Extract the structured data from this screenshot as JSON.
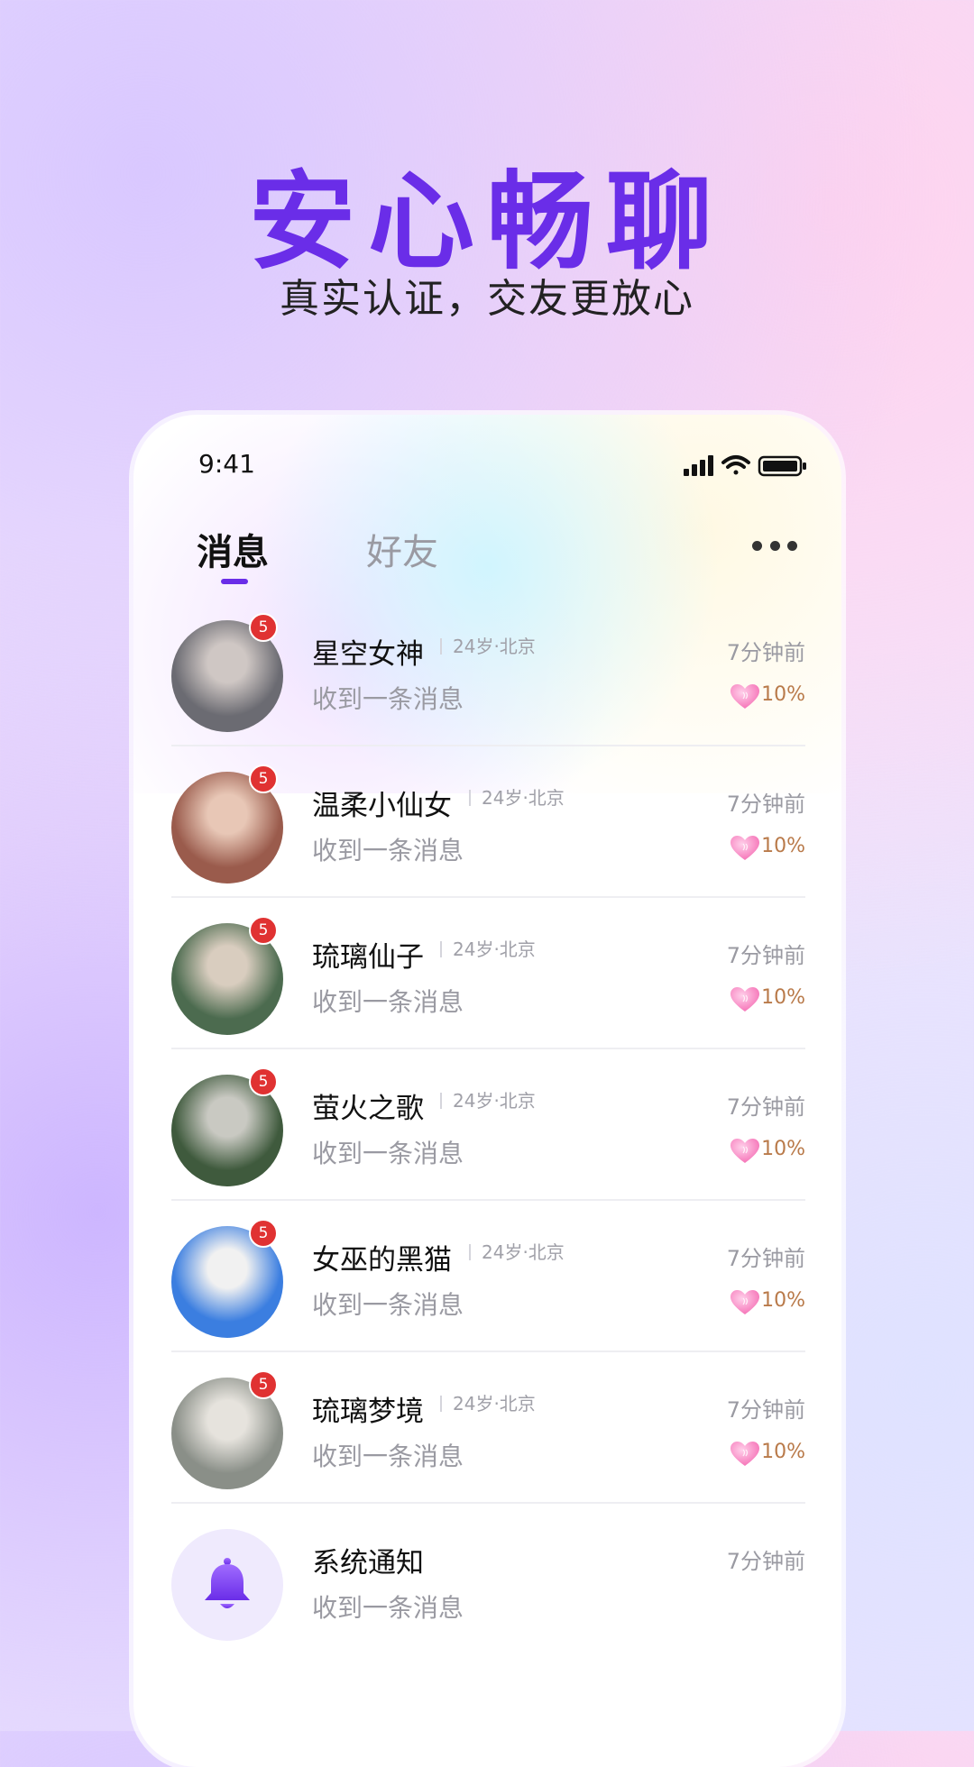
{
  "promo": {
    "headline": "安心畅聊",
    "subline": "真实认证，交友更放心"
  },
  "status_bar": {
    "time": "9:41"
  },
  "tabs": [
    {
      "label": "消息",
      "active": true
    },
    {
      "label": "好友",
      "active": false
    }
  ],
  "conversations": [
    {
      "name": "星空女神",
      "meta": "24岁·北京",
      "time": "7分钟前",
      "message": "收到一条消息",
      "badge": "5",
      "intimacy": "10%",
      "avatar_colors": [
        "#6b6b72",
        "#cfc7c4"
      ]
    },
    {
      "name": "温柔小仙女",
      "meta": "24岁·北京",
      "time": "7分钟前",
      "message": "收到一条消息",
      "badge": "5",
      "intimacy": "10%",
      "avatar_colors": [
        "#9a5b4c",
        "#e8c7b6"
      ]
    },
    {
      "name": "琉璃仙子",
      "meta": "24岁·北京",
      "time": "7分钟前",
      "message": "收到一条消息",
      "badge": "5",
      "intimacy": "10%",
      "avatar_colors": [
        "#4c6b4f",
        "#d9cdbf"
      ]
    },
    {
      "name": "萤火之歌",
      "meta": "24岁·北京",
      "time": "7分钟前",
      "message": "收到一条消息",
      "badge": "5",
      "intimacy": "10%",
      "avatar_colors": [
        "#3f5a3d",
        "#c9c9c2"
      ]
    },
    {
      "name": "女巫的黑猫",
      "meta": "24岁·北京",
      "time": "7分钟前",
      "message": "收到一条消息",
      "badge": "5",
      "intimacy": "10%",
      "avatar_colors": [
        "#3b7ee0",
        "#f1f1f1"
      ]
    },
    {
      "name": "琉璃梦境",
      "meta": "24岁·北京",
      "time": "7分钟前",
      "message": "收到一条消息",
      "badge": "5",
      "intimacy": "10%",
      "avatar_colors": [
        "#8a8f88",
        "#e6e3dd"
      ]
    }
  ],
  "system_notice": {
    "name": "系统通知",
    "time": "7分钟前",
    "message": "收到一条消息",
    "icon": "bell-icon"
  },
  "colors": {
    "accent": "#6a2de8",
    "badge": "#e03232",
    "heart": "#f78fc3",
    "intimacy_text": "#b97a4a"
  }
}
